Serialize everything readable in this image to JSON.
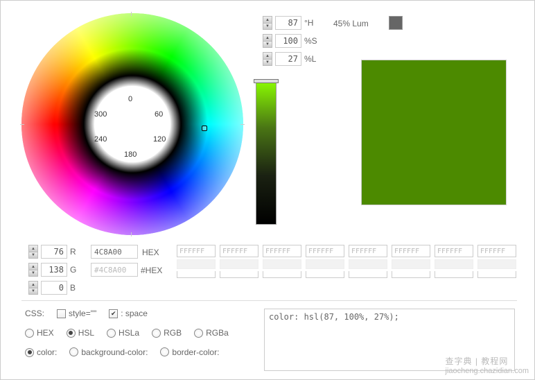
{
  "wheel": {
    "labels": {
      "0": "0",
      "60": "60",
      "120": "120",
      "180": "180",
      "240": "240",
      "300": "300"
    }
  },
  "hsl": {
    "h": "87",
    "h_unit": "°H",
    "s": "100",
    "s_unit": "%S",
    "l": "27",
    "l_unit": "%L"
  },
  "lum": {
    "label": "45% Lum"
  },
  "rgb": {
    "r": "76",
    "r_unit": "R",
    "g": "138",
    "g_unit": "G",
    "b": "0",
    "b_unit": "B"
  },
  "hex": {
    "value": "4C8A00",
    "label": "HEX",
    "hash_value": "#4C8A00",
    "hash_label": "#HEX"
  },
  "palette": {
    "default": "FFFFFF",
    "items": [
      "FFFFFF",
      "FFFFFF",
      "FFFFFF",
      "FFFFFF",
      "FFFFFF",
      "FFFFFF",
      "FFFFFF",
      "FFFFFF"
    ]
  },
  "css_controls": {
    "label": "CSS:",
    "style_attr": "style=\"\"",
    "space": ": space"
  },
  "format_radios": {
    "hex": "HEX",
    "hsl": "HSL",
    "hsla": "HSLa",
    "rgb": "RGB",
    "rgba": "RGBa",
    "selected": "hsl"
  },
  "property_radios": {
    "color": "color:",
    "bg": "background-color:",
    "border": "border-color:",
    "selected": "color"
  },
  "css_output": "color: hsl(87, 100%, 27%);",
  "watermark": {
    "cn": "查字典 | 教程网",
    "en": "jiaocheng.chazidian.com"
  }
}
